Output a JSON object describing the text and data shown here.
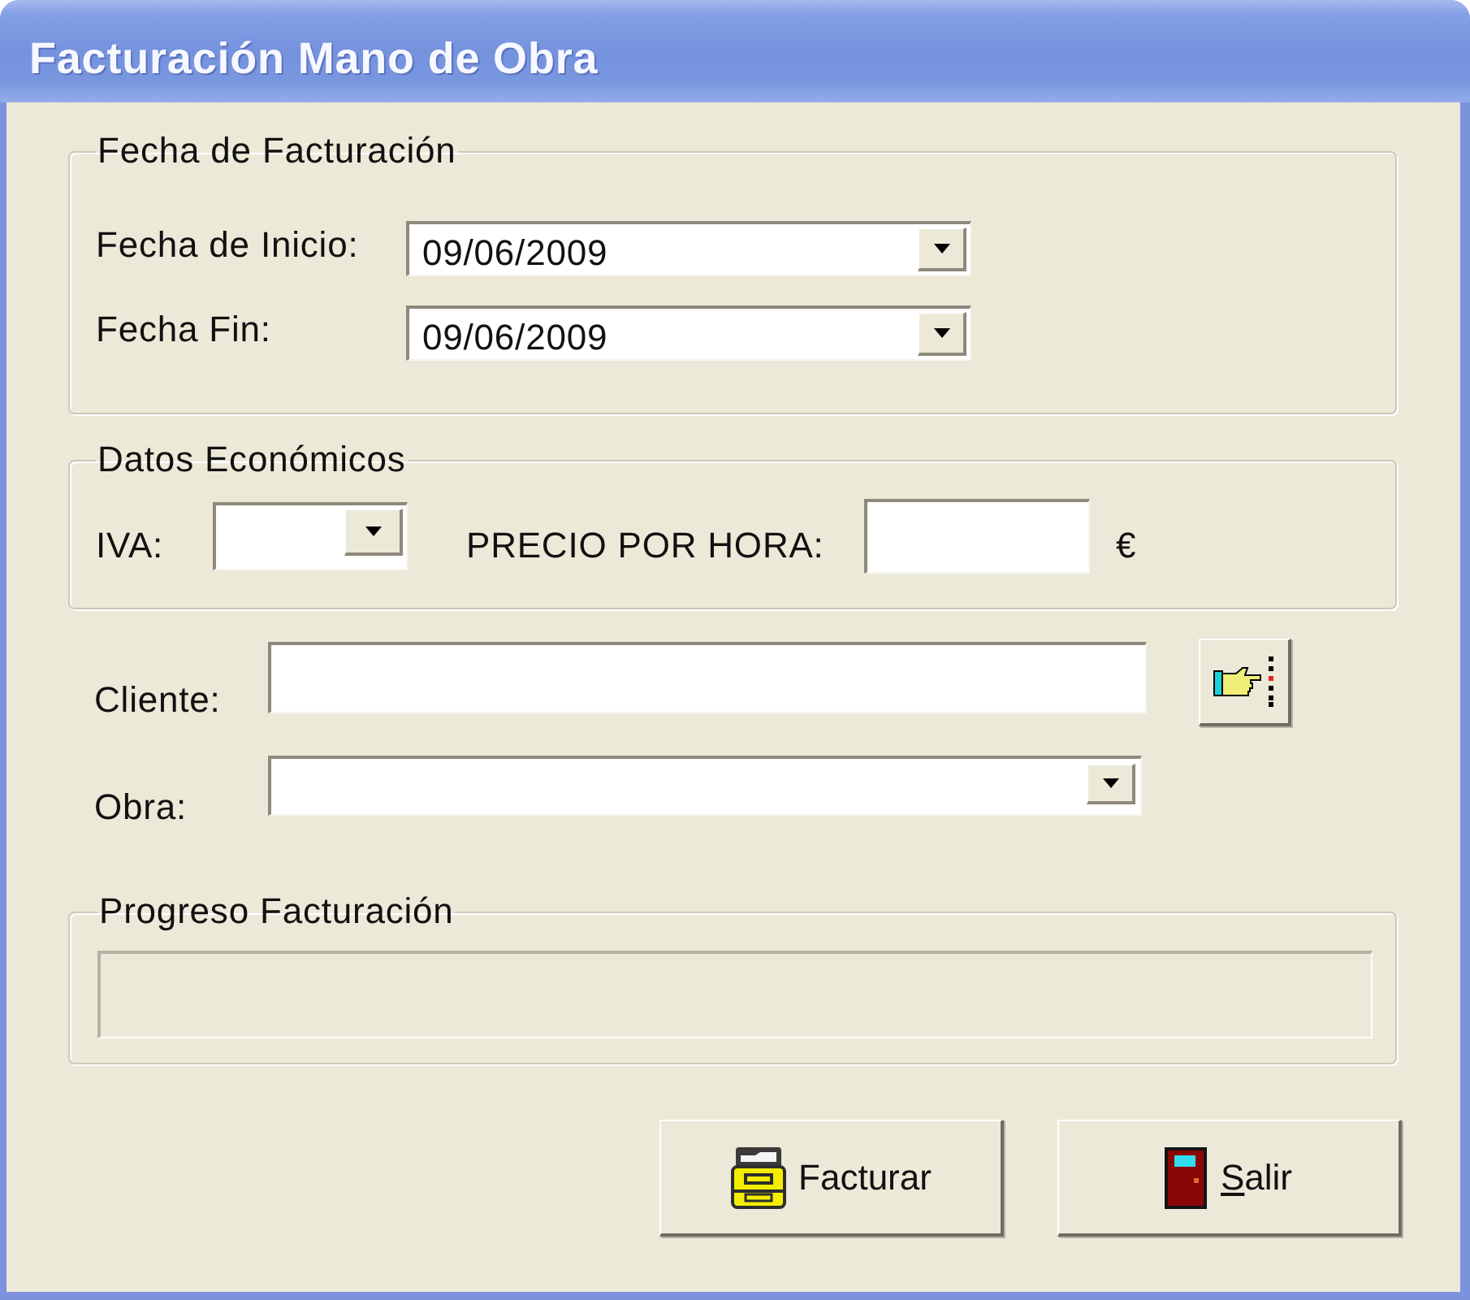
{
  "window": {
    "title": "Facturación Mano de Obra"
  },
  "billing_dates": {
    "legend": "Fecha de Facturación",
    "fields": [
      {
        "label": "Fecha de Inicio:",
        "value": "09/06/2009"
      },
      {
        "label": "Fecha Fin:",
        "value": "09/06/2009"
      }
    ]
  },
  "economic_data": {
    "legend": "Datos Económicos",
    "iva": {
      "label": "IVA:"
    },
    "price_per_hour": {
      "label": "PRECIO POR HORA:",
      "unit": "€"
    }
  },
  "client": {
    "label": "Cliente:"
  },
  "project": {
    "label": "Obra:"
  },
  "progress": {
    "legend": "Progreso Facturación",
    "level": 0
  },
  "buttons": [
    {
      "label": "Facturar",
      "kind": "invoice",
      "mnemonic": false
    },
    {
      "label": "Salir",
      "kind": "exit",
      "mnemonic": true
    }
  ]
}
